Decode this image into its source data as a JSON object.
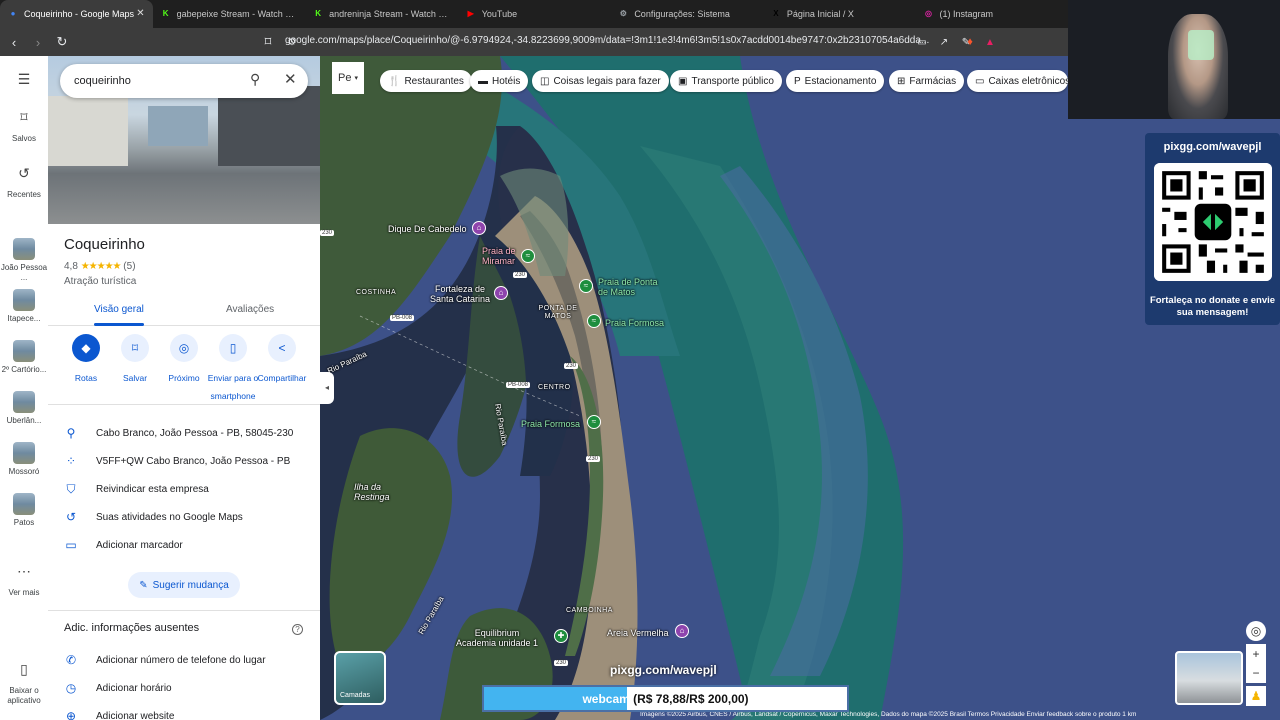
{
  "tabs": [
    {
      "title": "Coqueirinho - Google Maps",
      "fav_color": "#4285f4",
      "fav_glyph": "●",
      "active": true
    },
    {
      "title": "gabepeixe Stream - Watch Live on Kick",
      "fav_color": "#53fc18",
      "fav_glyph": "K"
    },
    {
      "title": "andreninja Stream - Watch Live on Kick",
      "fav_color": "#53fc18",
      "fav_glyph": "K"
    },
    {
      "title": "YouTube",
      "fav_color": "#ff0000",
      "fav_glyph": "▶"
    },
    {
      "title": "Configurações: Sistema",
      "fav_color": "#9aa0a6",
      "fav_glyph": "⚙"
    },
    {
      "title": "Página Inicial / X",
      "fav_color": "#000000",
      "fav_glyph": "X"
    },
    {
      "title": "(1) Instagram",
      "fav_color": "#d6249f",
      "fav_glyph": "◎"
    }
  ],
  "url": "google.com/maps/place/Coqueirinho/@-6.9794924,-34.8223699,9009m/data=!3m1!1e3!4m6!3m5!1s0x7acdd0014be9747:0x2b23107054a6dda...",
  "rail": {
    "menu_icon": "☰",
    "saved": "Salvos",
    "recent": "Recentes",
    "recents": [
      "João Pessoa ...",
      "Itapece...",
      "2º Cartório...",
      "Uberlân...",
      "Mossoró",
      "Patos"
    ],
    "more": "Ver mais",
    "download": "Baixar o aplicativo"
  },
  "search": {
    "query": "coqueirinho"
  },
  "place": {
    "name": "Coqueirinho",
    "rating": "4,8",
    "stars": "★★★★★",
    "reviews": "(5)",
    "type": "Atração turística"
  },
  "place_tabs": {
    "overview": "Visão geral",
    "reviews": "Avaliações"
  },
  "actions": [
    {
      "label": "Rotas",
      "icon": "◆"
    },
    {
      "label": "Salvar",
      "icon": "⌑"
    },
    {
      "label": "Próximo",
      "icon": "◎"
    },
    {
      "label": "Enviar para o smartphone",
      "icon": "▯"
    },
    {
      "label": "Compartilhar",
      "icon": "<"
    }
  ],
  "info_rows": [
    {
      "icon": "⚲",
      "text": "Cabo Branco, João Pessoa - PB, 58045-230"
    },
    {
      "icon": "⁘",
      "text": "V5FF+QW Cabo Branco, João Pessoa - PB"
    },
    {
      "icon": "⛉",
      "text": "Reivindicar esta empresa"
    },
    {
      "icon": "↺",
      "text": "Suas atividades no Google Maps"
    },
    {
      "icon": "▭",
      "text": "Adicionar marcador"
    }
  ],
  "suggest": "Sugerir mudança",
  "missing": {
    "title": "Adic. informações ausentes",
    "rows": [
      {
        "icon": "✆",
        "text": "Adicionar número de telefone do lugar"
      },
      {
        "icon": "◷",
        "text": "Adicionar horário"
      },
      {
        "icon": "⊕",
        "text": "Adicionar website"
      }
    ]
  },
  "map": {
    "peg": "Pe",
    "chips": [
      {
        "icon": "🍴",
        "label": "Restaurantes"
      },
      {
        "icon": "▬",
        "label": "Hotéis"
      },
      {
        "icon": "◫",
        "label": "Coisas legais para fazer"
      },
      {
        "icon": "▣",
        "label": "Transporte público"
      },
      {
        "icon": "P",
        "label": "Estacionamento"
      },
      {
        "icon": "⊞",
        "label": "Farmácias"
      },
      {
        "icon": "▭",
        "label": "Caixas eletrônicos"
      }
    ],
    "places": {
      "dique": "Dique De Cabedelo",
      "praia_miramar": "Praia de Miramar",
      "fortaleza": "Fortaleza de Santa Catarina",
      "costinha": "COSTINHA",
      "ponta_matos_praia": "Praia de Ponta de Matos",
      "ponta_matos": "PONTA DE MATOS",
      "formosa1": "Praia Formosa",
      "centro": "CENTRO",
      "rio1": "Rio Paraíba",
      "formosa2": "Praia Formosa",
      "ilha": "Ilha da Restinga",
      "camboinha": "CAMBOINHA",
      "equilibrium": "Equilibrium Academia unidade 1",
      "areia": "Areia Vermelha",
      "rio2": "Rio Paraíba",
      "rio3": "Rio Paraíba"
    },
    "shields": [
      "230",
      "230",
      "230",
      "PB-008",
      "PB-008",
      "230",
      "230"
    ],
    "layers": "Camadas",
    "attribution": "Imagens ©2025 Airbus, CNES / Airbus, Landsat / Copernicus, Maxar Technologies, Dados do mapa ©2025    Brasil    Termos    Privacidade    Enviar feedback sobre o produto    1 km"
  },
  "overlay": {
    "qr_top": "pixgg.com/wavepjl",
    "qr_bottom": "Fortaleça no donate e envie sua mensagem!",
    "donate_url": "pixgg.com/wavepjl",
    "goal_label": "webcam",
    "goal_amount": "(R$ 78,88/R$ 200,00)",
    "goal_progress": 0.394
  },
  "colors": {
    "accent": "#0b57d0",
    "star": "#f5b400",
    "poi_green": "#1e8e3e",
    "poi_purple": "#8e44ad"
  }
}
